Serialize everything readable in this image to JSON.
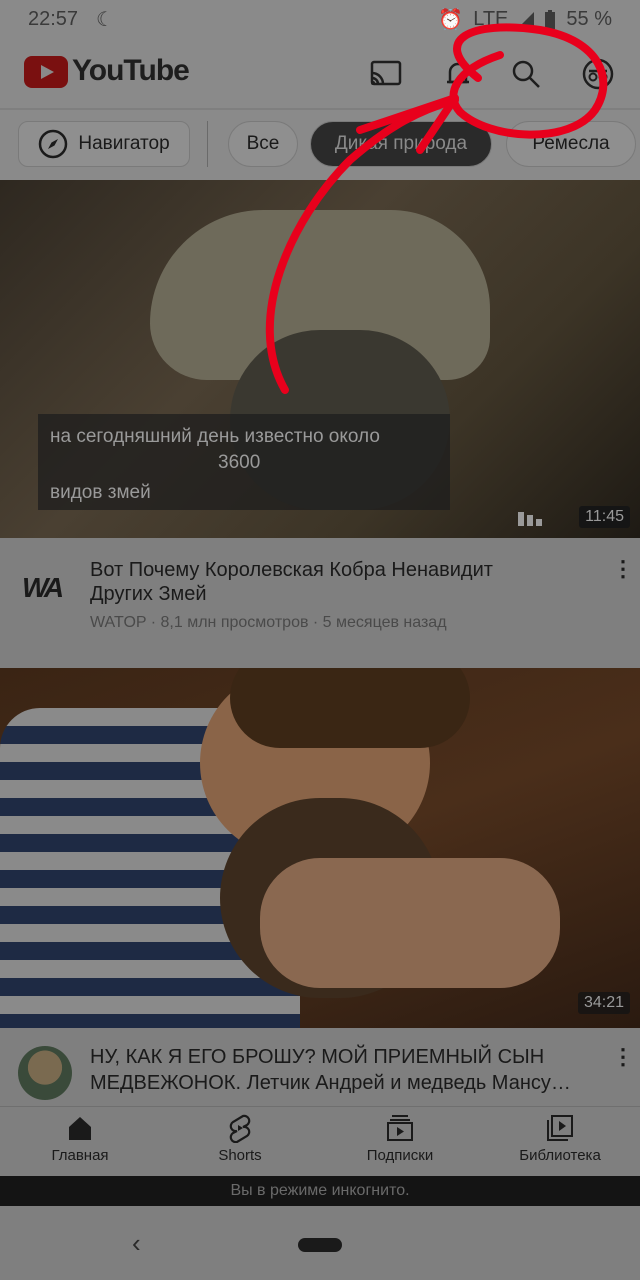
{
  "status_bar": {
    "time": "22:57",
    "network": "LTE",
    "battery": "55 %"
  },
  "header": {
    "logo_text": "YouTube",
    "icons": [
      "cast-icon",
      "bell-icon",
      "search-icon",
      "incognito-icon"
    ]
  },
  "chips": {
    "explore": "Навигатор",
    "items": [
      "Все",
      "Дикая природа",
      "Ремесла"
    ],
    "active": "Дикая природа"
  },
  "videos": [
    {
      "caption": [
        "на сегодняшний день известно около",
        "3600",
        "видов змей"
      ],
      "duration": "11:45",
      "channel_logo": "WA",
      "title": "Вот Почему  Королевская Кобра Ненавидит Других Змей",
      "meta": "WATOP · 8,1 млн просмотров · 5 месяцев назад"
    },
    {
      "duration": "34:21",
      "title": "НУ, КАК Я ЕГО БРОШУ? МОЙ ПРИЕМНЫЙ СЫН МЕДВЕЖОНОК. Летчик Андрей и медведь Мансу…"
    }
  ],
  "bottom_nav": [
    {
      "label": "Главная",
      "icon": "home-icon"
    },
    {
      "label": "Shorts",
      "icon": "shorts-icon"
    },
    {
      "label": "Подписки",
      "icon": "subscriptions-icon"
    },
    {
      "label": "Библиотека",
      "icon": "library-icon"
    }
  ],
  "incognito_banner": "Вы в режиме инкогнито.",
  "colors": {
    "overlay_gray": "#7f7f7f",
    "annotation_red": "#e8001c"
  }
}
